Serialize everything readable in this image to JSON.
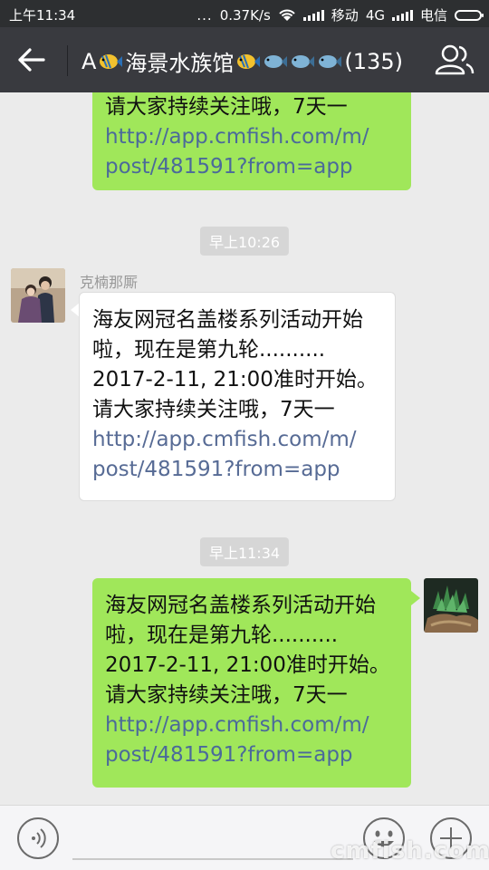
{
  "status_bar": {
    "time": "上午11:34",
    "dots": "...",
    "speed": "0.37K/s",
    "carrier1": "移动",
    "network": "4G",
    "carrier2": "电信"
  },
  "header": {
    "title_a": "A",
    "title_text": "海景水族馆",
    "member_count": "(135)"
  },
  "messages": [
    {
      "type": "mine",
      "lines": [
        "请大家持续关注哦，7天一"
      ],
      "link_lines": [
        "http://app.cmfish.com/m/",
        "post/481591?from=app"
      ]
    },
    {
      "type": "time",
      "text": "早上10:26"
    },
    {
      "type": "theirs",
      "sender": "克楠那厮",
      "lines": [
        "海友网冠名盖楼系列活动开始",
        "啦，现在是第九轮..........",
        "2017-2-11, 21:00准时开始。",
        "请大家持续关注哦，7天一"
      ],
      "link_lines": [
        "http://app.cmfish.com/m/",
        "post/481591?from=app"
      ]
    },
    {
      "type": "time",
      "text": "早上11:34"
    },
    {
      "type": "mine",
      "lines": [
        "海友网冠名盖楼系列活动开始",
        "啦，现在是第九轮..........",
        "2017-2-11, 21:00准时开始。",
        "请大家持续关注哦，7天一"
      ],
      "link_lines": [
        "http://app.cmfish.com/m/",
        "post/481591?from=app"
      ]
    }
  ],
  "watermark": "cmfish.com",
  "colors": {
    "my_bubble": "#a0e75a",
    "their_bubble": "#ffffff",
    "header_bg": "#393a3f",
    "chat_bg": "#ebebeb",
    "link": "#576b95"
  },
  "icons": [
    "back-arrow-icon",
    "fish-icon",
    "members-icon",
    "voice-icon",
    "emoji-icon",
    "plus-icon",
    "wifi-icon",
    "signal-icon",
    "battery-icon"
  ]
}
